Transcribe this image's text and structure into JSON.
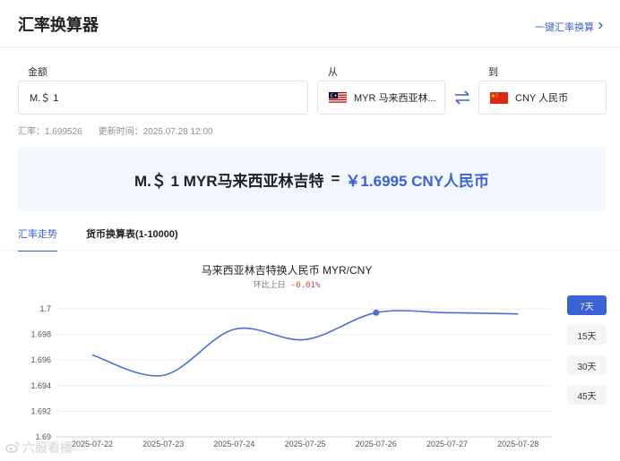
{
  "header": {
    "title": "汇率换算器",
    "one_key_link": "一键汇率换算",
    "chevron": "chevron-right-icon"
  },
  "form": {
    "amount_label": "金额",
    "amount_value": "M.＄  1",
    "from_label": "从",
    "from_currency": "MYR  马来西亚林...",
    "to_label": "到",
    "to_currency": "CNY  人民币",
    "swap_icon": "swap-icon"
  },
  "rate_meta": {
    "rate": "汇率：1.699526",
    "update_time": "更新时间：2025.07.28 12:00"
  },
  "result": {
    "left": "M.＄ 1 MYR马来西亚林吉特",
    "equals": "=",
    "right": "￥1.6995 CNY人民币"
  },
  "tabs": [
    {
      "label": "汇率走势",
      "active": true
    },
    {
      "label": "货币换算表(1-10000)",
      "active": false
    }
  ],
  "ranges": [
    {
      "label": "7天",
      "active": true
    },
    {
      "label": "15天",
      "active": false
    },
    {
      "label": "30天",
      "active": false
    },
    {
      "label": "45天",
      "active": false
    }
  ],
  "chart_data": {
    "type": "line",
    "title": "马来西亚林吉特换人民币   MYR/CNY",
    "subtitle": "环比上日",
    "change": "-0.01%",
    "x": [
      "2025-07-22",
      "2025-07-23",
      "2025-07-24",
      "2025-07-25",
      "2025-07-26",
      "2025-07-27",
      "2025-07-28"
    ],
    "values": [
      1.6964,
      1.6948,
      1.6984,
      1.6976,
      1.6997,
      1.6997,
      1.6996
    ],
    "highlight_index": 4,
    "ylim": [
      1.69,
      1.7
    ],
    "yticks": [
      1.69,
      1.692,
      1.694,
      1.696,
      1.698,
      1.7
    ],
    "grid": true,
    "line_color": "#4a6fd8"
  },
  "watermark": "六股看播",
  "watermark_icon": "weibo-icon"
}
